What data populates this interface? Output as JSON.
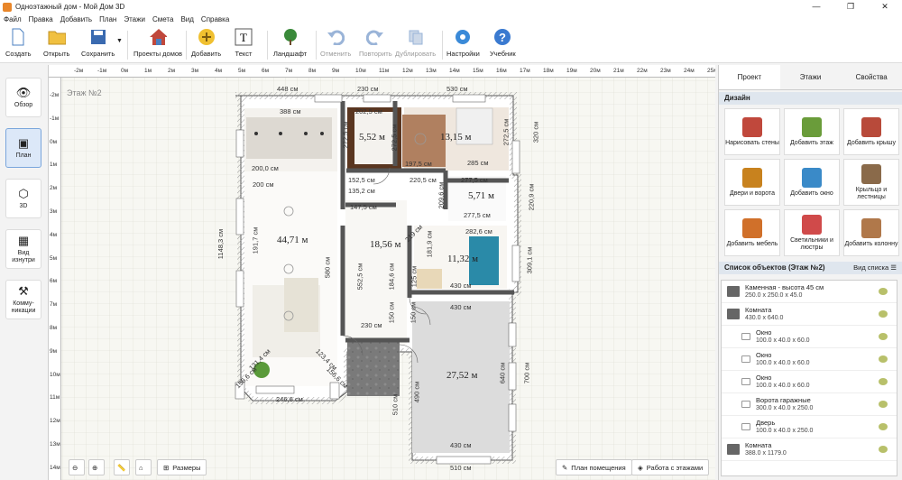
{
  "window": {
    "title": "Одноэтажный дом - Мой Дом 3D",
    "min": "—",
    "max": "❐",
    "close": "✕"
  },
  "menu": [
    "Файл",
    "Правка",
    "Добавить",
    "План",
    "Этажи",
    "Смета",
    "Вид",
    "Справка"
  ],
  "toolbar": {
    "create": "Создать",
    "open": "Открыть",
    "save": "Сохранить",
    "projects": "Проекты домов",
    "add": "Добавить",
    "text": "Текст",
    "landscape": "Ландшафт",
    "undo": "Отменить",
    "redo": "Повторить",
    "duplicate": "Дублировать",
    "settings": "Настройки",
    "tutorial": "Учебник"
  },
  "left": {
    "overview": "Обзор",
    "plan": "План",
    "view3d": "3D",
    "view_measured": "Вид изнутри",
    "comms": "Комму-никации"
  },
  "canvas": {
    "floor_label": "Этаж №2",
    "ruler_top": [
      "-2м",
      "-1м",
      "0м",
      "1м",
      "2м",
      "3м",
      "4м",
      "5м",
      "6м",
      "7м",
      "8м",
      "9м",
      "10м",
      "11м",
      "12м",
      "13м",
      "14м",
      "15м",
      "16м",
      "17м",
      "18м",
      "19м",
      "20м",
      "21м",
      "22м",
      "23м",
      "24м",
      "25м"
    ],
    "ruler_left": [
      "-2м",
      "-1м",
      "0м",
      "1м",
      "2м",
      "3м",
      "4м",
      "5м",
      "6м",
      "7м",
      "8м",
      "9м",
      "10м",
      "11м",
      "12м",
      "13м",
      "14м"
    ],
    "dims": {
      "d448": "448 см",
      "d230top": "230 см",
      "d530": "530 см",
      "d388": "388 см",
      "d2025": "202,5 см",
      "d2725a": "272,5 см",
      "d2725b": "272,5 см",
      "d320": "320 см",
      "d200a": "200 см",
      "d200b": "200 см",
      "d2000": "200,0 см",
      "d1975": "197,5 см",
      "d285": "285 см",
      "d1148": "1148,3 см",
      "d1525": "152,5 см",
      "d1475": "147,5 см",
      "d1352": "135,2 см",
      "d2096": "209,6 см",
      "d2775a": "277,5 см",
      "d2775b": "277,5 см",
      "d2205": "220,5 см",
      "d2209": "220,9 см",
      "d2826": "282,6 см",
      "d219": "219 см",
      "d1819": "181,9 см",
      "d3091": "309,1 см",
      "d1846": "184,6 см",
      "d125": "125 см",
      "d5525": "552,5 см",
      "d580": "580 см",
      "d430a": "430 см",
      "d430b": "430 см",
      "d430c": "430 см",
      "d1917": "191,7 см",
      "d230mid": "230 см",
      "d150a": "150 см",
      "d150b": "150 см",
      "d640": "640 см",
      "d700": "700 см",
      "d490": "490 см",
      "d510a": "510 см",
      "d510b": "510 см",
      "d1566a": "156,6 см",
      "d1566b": "156,6 см",
      "d1314": "131,4 см",
      "d2466": "246,6 см",
      "d1234": "123,4 см"
    },
    "areas": {
      "a1": "44,71 м",
      "a2": "5,52 м",
      "a3": "13,15 м",
      "a4": "18,56 м",
      "a5": "5,71 м",
      "a6": "11,32 м",
      "a7": "27,52 м"
    },
    "bottom": {
      "sizes": "Размеры",
      "room_plan": "План помещения",
      "floors_work": "Работа с этажами"
    }
  },
  "panel": {
    "tabs": [
      "Проект",
      "Этажи",
      "Свойства"
    ],
    "design_header": "Дизайн",
    "design": [
      {
        "label": "Нарисовать стены",
        "color": "#c0483c"
      },
      {
        "label": "Добавить этаж",
        "color": "#6a9c3a"
      },
      {
        "label": "Добавить крышу",
        "color": "#b84a3a"
      },
      {
        "label": "Двери и ворота",
        "color": "#c8821e"
      },
      {
        "label": "Добавить окно",
        "color": "#3a8ac8"
      },
      {
        "label": "Крыльцо и лестницы",
        "color": "#8a6a4a"
      },
      {
        "label": "Добавить мебель",
        "color": "#d0702a"
      },
      {
        "label": "Светильники и люстры",
        "color": "#d04a4a"
      },
      {
        "label": "Добавить колонну",
        "color": "#b0784a"
      }
    ],
    "list_header": "Список объектов (Этаж №2)",
    "view_list": "Вид списка",
    "objects": [
      {
        "name": "Каменная - высота 45 см",
        "dims": "250.0 x 250.0 x 45.0",
        "sub": false
      },
      {
        "name": "Комната",
        "dims": "430.0 x 640.0",
        "sub": false
      },
      {
        "name": "Окно",
        "dims": "100.0 x 40.0 x 60.0",
        "sub": true
      },
      {
        "name": "Окно",
        "dims": "100.0 x 40.0 x 60.0",
        "sub": true
      },
      {
        "name": "Окно",
        "dims": "100.0 x 40.0 x 60.0",
        "sub": true
      },
      {
        "name": "Ворота гаражные",
        "dims": "300.0 x 40.0 x 250.0",
        "sub": true
      },
      {
        "name": "Дверь",
        "dims": "100.0 x 40.0 x 250.0",
        "sub": true
      },
      {
        "name": "Комната",
        "dims": "388.0 x 1179.0",
        "sub": false
      }
    ]
  }
}
